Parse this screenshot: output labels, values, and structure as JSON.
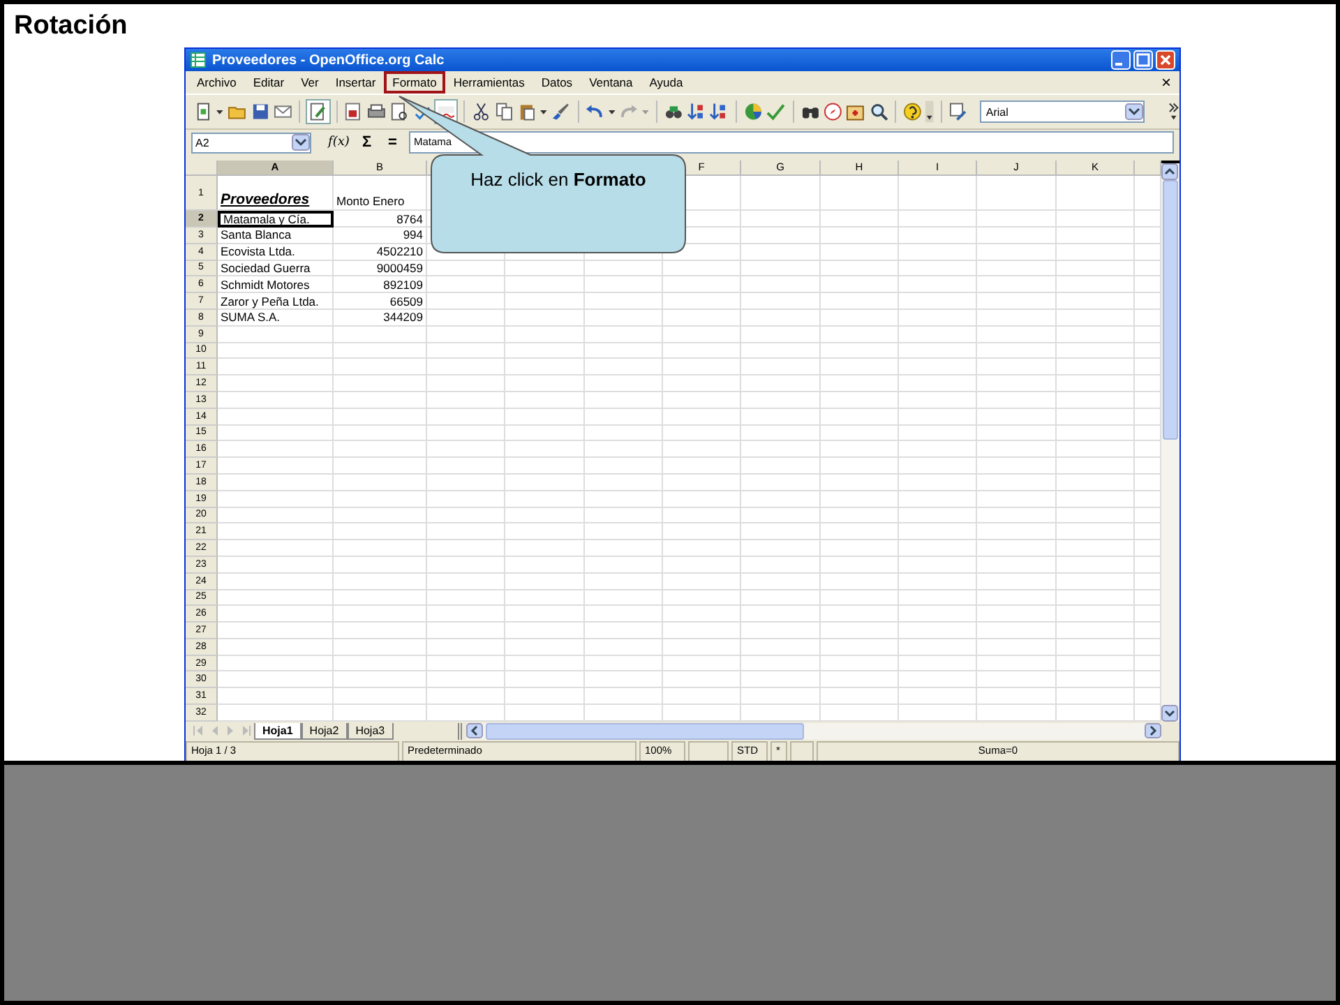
{
  "slide": {
    "title": "Rotación"
  },
  "window": {
    "title": "Proveedores - OpenOffice.org Calc"
  },
  "menu": [
    {
      "label": "Archivo",
      "highlighted": false
    },
    {
      "label": "Editar",
      "highlighted": false
    },
    {
      "label": "Ver",
      "highlighted": false
    },
    {
      "label": "Insertar",
      "highlighted": false
    },
    {
      "label": "Formato",
      "highlighted": true
    },
    {
      "label": "Herramientas",
      "highlighted": false
    },
    {
      "label": "Datos",
      "highlighted": false
    },
    {
      "label": "Ventana",
      "highlighted": false
    },
    {
      "label": "Ayuda",
      "highlighted": false
    }
  ],
  "menu_close": "×",
  "toolbar": {
    "font_name": "Arial"
  },
  "formula_bar": {
    "cell_ref": "A2",
    "function_icon": "f(x)",
    "sum_icon": "Σ",
    "equals_icon": "=",
    "content": "Matama"
  },
  "columns": [
    {
      "label": "A",
      "selected": true
    },
    {
      "label": "B",
      "selected": false
    },
    {
      "label": "F",
      "selected": false
    },
    {
      "label": "G",
      "selected": false
    },
    {
      "label": "H",
      "selected": false
    },
    {
      "label": "I",
      "selected": false
    },
    {
      "label": "J",
      "selected": false
    },
    {
      "label": "K",
      "selected": false
    }
  ],
  "rows": [
    {
      "header": "1",
      "kind": "heading",
      "selected": false,
      "cells": [
        "Proveedores",
        "Monto Enero"
      ]
    },
    {
      "header": "2",
      "kind": "data",
      "selected": true,
      "cells": [
        "Matamala y Cía.",
        "8764"
      ]
    },
    {
      "header": "3",
      "kind": "data",
      "selected": false,
      "cells": [
        "Santa Blanca",
        "994"
      ]
    },
    {
      "header": "4",
      "kind": "data",
      "selected": false,
      "cells": [
        "Ecovista Ltda.",
        "4502210"
      ]
    },
    {
      "header": "5",
      "kind": "data",
      "selected": false,
      "cells": [
        "Sociedad Guerra",
        "9000459"
      ]
    },
    {
      "header": "6",
      "kind": "data",
      "selected": false,
      "cells": [
        "Schmidt Motores",
        "892109"
      ]
    },
    {
      "header": "7",
      "kind": "data",
      "selected": false,
      "cells": [
        "Zaror y Peña Ltda.",
        "66509"
      ]
    },
    {
      "header": "8",
      "kind": "data",
      "selected": false,
      "cells": [
        "SUMA S.A.",
        "344209"
      ]
    },
    {
      "header": "9",
      "kind": "data",
      "selected": false
    },
    {
      "header": "10",
      "kind": "data",
      "selected": false
    },
    {
      "header": "11",
      "kind": "data",
      "selected": false
    },
    {
      "header": "12",
      "kind": "data",
      "selected": false
    },
    {
      "header": "13",
      "kind": "data",
      "selected": false
    },
    {
      "header": "14",
      "kind": "data",
      "selected": false
    },
    {
      "header": "15",
      "kind": "data",
      "selected": false
    },
    {
      "header": "16",
      "kind": "data",
      "selected": false
    },
    {
      "header": "17",
      "kind": "data",
      "selected": false
    },
    {
      "header": "18",
      "kind": "data",
      "selected": false
    },
    {
      "header": "19",
      "kind": "data",
      "selected": false
    },
    {
      "header": "20",
      "kind": "data",
      "selected": false
    },
    {
      "header": "21",
      "kind": "data",
      "selected": false
    },
    {
      "header": "22",
      "kind": "data",
      "selected": false
    },
    {
      "header": "23",
      "kind": "data",
      "selected": false
    },
    {
      "header": "24",
      "kind": "data",
      "selected": false
    },
    {
      "header": "25",
      "kind": "data",
      "selected": false
    },
    {
      "header": "26",
      "kind": "data",
      "selected": false
    },
    {
      "header": "27",
      "kind": "data",
      "selected": false
    },
    {
      "header": "28",
      "kind": "data",
      "selected": false
    },
    {
      "header": "29",
      "kind": "data",
      "selected": false
    },
    {
      "header": "30",
      "kind": "data",
      "selected": false
    },
    {
      "header": "31",
      "kind": "data",
      "selected": false
    },
    {
      "header": "32",
      "kind": "data",
      "selected": false
    }
  ],
  "sheet_tabs": [
    {
      "label": "Hoja1",
      "selected": true
    },
    {
      "label": "Hoja2",
      "selected": false
    },
    {
      "label": "Hoja3",
      "selected": false
    }
  ],
  "status_bar": [
    {
      "kind": "text",
      "text": "Hoja 1 / 3"
    },
    {
      "kind": "text",
      "text": "Predeterminado"
    },
    {
      "kind": "text",
      "text": "100%"
    },
    {
      "kind": "blank"
    },
    {
      "kind": "text",
      "text": "STD"
    },
    {
      "kind": "text",
      "text": "*"
    },
    {
      "kind": "blank"
    },
    {
      "kind": "text",
      "text": "Suma=0"
    }
  ],
  "callout": {
    "text": "Haz click en **Formato**"
  }
}
